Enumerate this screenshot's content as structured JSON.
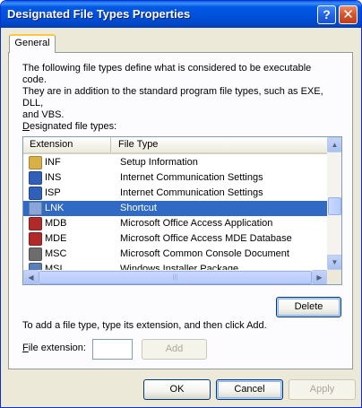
{
  "window": {
    "title": "Designated File Types Properties"
  },
  "tabs": [
    {
      "label": "General"
    }
  ],
  "description": {
    "line1": "The following file types define what is considered to be executable code.",
    "line2": "They are in addition to the standard program file types, such as EXE, DLL,",
    "line3": "and VBS."
  },
  "list": {
    "label_prefix": "D",
    "label_rest": "esignated file types:",
    "headers": {
      "extension": "Extension",
      "file_type": "File Type"
    },
    "rows": [
      {
        "ext": "INF",
        "type": "Setup Information",
        "icon": "inf-file-icon",
        "color": "#d8b046",
        "selected": false
      },
      {
        "ext": "INS",
        "type": "Internet Communication Settings",
        "icon": "ins-file-icon",
        "color": "#2f5fb8",
        "selected": false
      },
      {
        "ext": "ISP",
        "type": "Internet Communication Settings",
        "icon": "isp-file-icon",
        "color": "#2f5fb8",
        "selected": false
      },
      {
        "ext": "LNK",
        "type": "Shortcut",
        "icon": "shortcut-file-icon",
        "color": "#8aa6d8",
        "selected": true
      },
      {
        "ext": "MDB",
        "type": "Microsoft Office Access Application",
        "icon": "mdb-file-icon",
        "color": "#b02a2a",
        "selected": false
      },
      {
        "ext": "MDE",
        "type": "Microsoft Office Access MDE Database",
        "icon": "mde-file-icon",
        "color": "#b02a2a",
        "selected": false
      },
      {
        "ext": "MSC",
        "type": "Microsoft Common Console Document",
        "icon": "msc-file-icon",
        "color": "#6d6d6d",
        "selected": false
      },
      {
        "ext": "MSI",
        "type": "Windows Installer Package",
        "icon": "msi-file-icon",
        "color": "#5a7fb5",
        "selected": false
      }
    ]
  },
  "buttons": {
    "delete": "Delete",
    "add": "Add",
    "ok": "OK",
    "cancel": "Cancel",
    "apply": "Apply"
  },
  "add_help": "To add a file type, type its extension, and then click Add.",
  "file_extension": {
    "label_prefix": "F",
    "label_rest": "ile extension:",
    "value": ""
  },
  "colors": {
    "selection": "#316ac5",
    "titlebar": "#0054e3"
  }
}
